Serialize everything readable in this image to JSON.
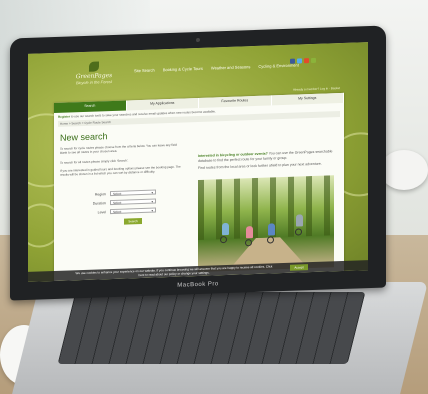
{
  "device": {
    "brand": "MacBook Pro"
  },
  "site": {
    "logo_name": "GreenPages",
    "logo_tagline": "Bicycle in the Forest",
    "nav": [
      "Site Search",
      "Booking & Cycle Tours",
      "Weather and Seasons",
      "Cycling & Environment"
    ],
    "social_colors": [
      "#3b5998",
      "#55acee",
      "#e24b2b",
      "#8bb33a"
    ],
    "topline": "Already a member? Log in  ·  Basket",
    "tabs": [
      "Search",
      "My Applications",
      "Favourite Routes",
      "My Settings"
    ],
    "active_tab": 0,
    "notice_bold": "Register",
    "notice_text": "to use our search tools to save your searches and receive email updates when new routes become available.",
    "breadcrumb": "Home > Search > Cycle Route Search",
    "title": "New search",
    "para1": "To search for cycle routes please choose from the criteria below. You can leave any field blank to see all routes in your chosen area.",
    "para2": "To search for all routes please simply click 'Search'.",
    "para3": "If you are interested in guided tours and booking options please see the booking page. The results will be shown in a list which you can sort by distance or difficulty.",
    "fields": [
      {
        "label": "Region",
        "value": "Select"
      },
      {
        "label": "Duration",
        "value": "Select"
      },
      {
        "label": "Level",
        "value": "Select"
      }
    ],
    "submit_label": "Search",
    "right_intro_bold": "Interested in bicycling or outdoor events?",
    "right_intro": "You can use the GreenPages searchable database to find the perfect route for your family or group.",
    "right_intro2": "Find routes from the local area or look further afield to plan your next adventure.",
    "cookie_text": "We use cookies to enhance your experience on our website. If you continue browsing we will assume that you are happy to receive all cookies. Click here to read about our policy or change your settings.",
    "cookie_button": "Accept"
  }
}
